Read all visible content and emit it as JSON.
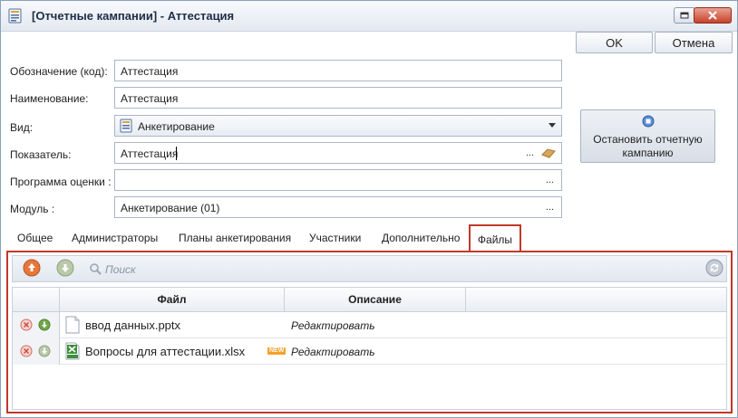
{
  "window": {
    "title": "[Отчетные кампании] - Аттестация"
  },
  "actions": {
    "ok_label": "OK",
    "cancel_label": "Отмена"
  },
  "form": {
    "code": {
      "label": "Обозначение (код):",
      "value": "Аттестация"
    },
    "name": {
      "label": "Наименование:",
      "value": "Аттестация"
    },
    "kind": {
      "label": "Вид:",
      "value": "Анкетирование"
    },
    "indicator": {
      "label": "Показатель:",
      "value": "Аттестация"
    },
    "program": {
      "label": "Программа оценки :",
      "value": ""
    },
    "module": {
      "label": "Модуль :",
      "value": "Анкетирование (01)"
    },
    "lookup_button": "..."
  },
  "stop_button": {
    "label": "Остановить отчетную кампанию"
  },
  "tabs": [
    {
      "label": "Общее"
    },
    {
      "label": "Администраторы"
    },
    {
      "label": "Планы анкетирования"
    },
    {
      "label": "Участники"
    },
    {
      "label": "Дополнительно"
    },
    {
      "label": "Файлы",
      "active": true
    }
  ],
  "files_toolbar": {
    "search_label": "Поиск"
  },
  "files_table": {
    "columns": [
      "Файл",
      "Описание"
    ],
    "rows": [
      {
        "file": "ввод данных.pptx",
        "description": "Редактировать",
        "is_new": false
      },
      {
        "file": "Вопросы для аттестации.xlsx",
        "description": "Редактировать",
        "is_new": true,
        "badge": "NEW"
      }
    ]
  },
  "colors": {
    "accent_red": "#c0392b",
    "upload_orange": "#e8773a",
    "download_green": "#6fa84a"
  }
}
